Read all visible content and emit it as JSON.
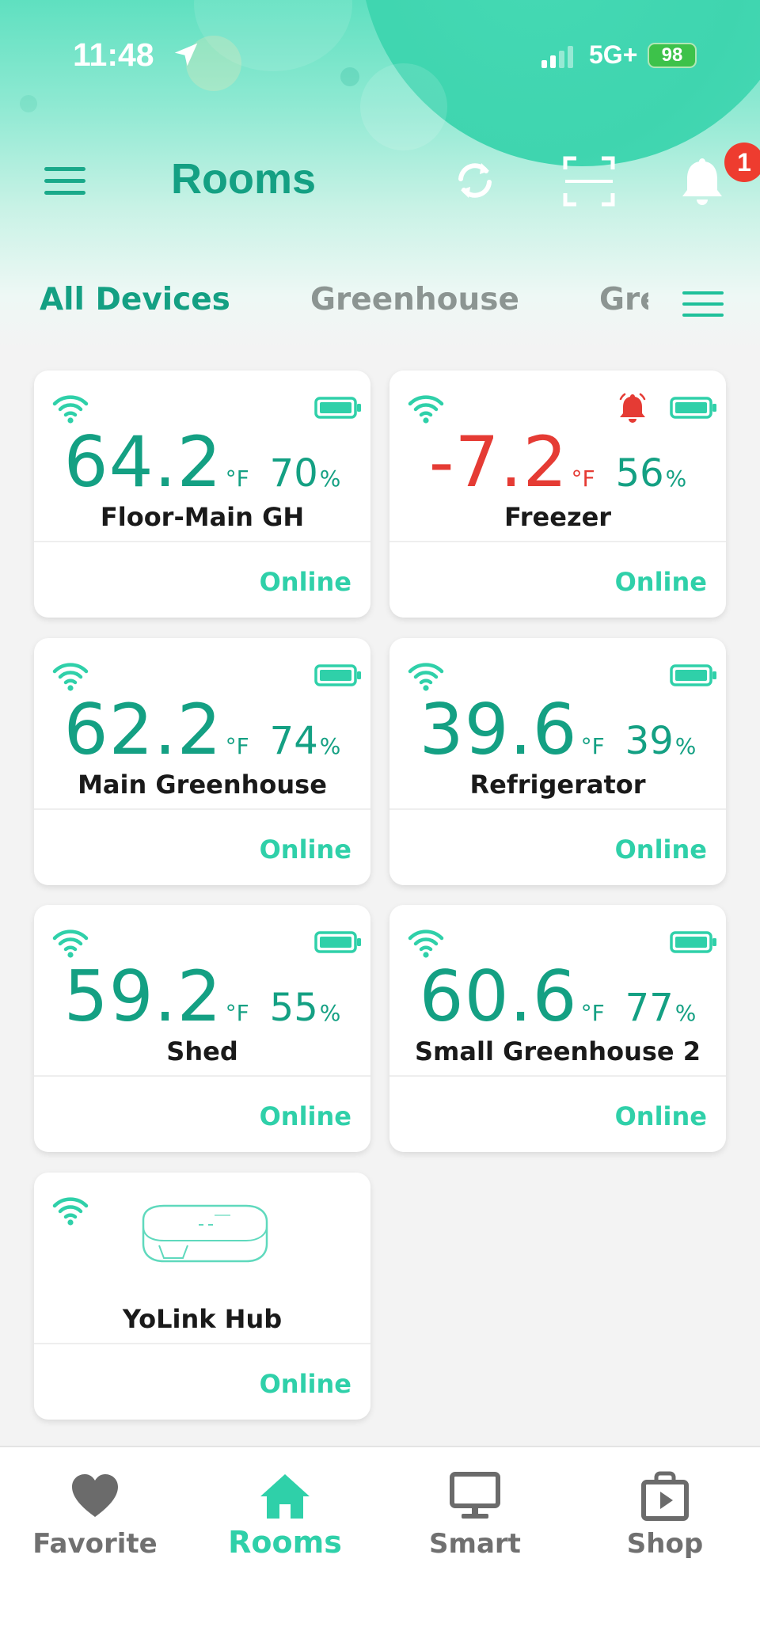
{
  "status_bar": {
    "time": "11:48",
    "network": "5G+",
    "battery": "98"
  },
  "header": {
    "title": "Rooms",
    "notification_count": "1"
  },
  "tabs": [
    {
      "label": "All Devices",
      "active": true
    },
    {
      "label": "Greenhouse",
      "active": false
    },
    {
      "label": "Greenhouse",
      "active": false
    }
  ],
  "devices": [
    {
      "name": "Floor-Main GH",
      "temp": "64.2",
      "temp_unit": "°F",
      "humidity": "70",
      "humidity_unit": "%",
      "status": "Online",
      "alarm": false
    },
    {
      "name": "Freezer",
      "temp": "-7.2",
      "temp_unit": "°F",
      "humidity": "56",
      "humidity_unit": "%",
      "status": "Online",
      "alarm": true
    },
    {
      "name": "Main Greenhouse",
      "temp": "62.2",
      "temp_unit": "°F",
      "humidity": "74",
      "humidity_unit": "%",
      "status": "Online",
      "alarm": false
    },
    {
      "name": "Refrigerator",
      "temp": "39.6",
      "temp_unit": "°F",
      "humidity": "39",
      "humidity_unit": "%",
      "status": "Online",
      "alarm": false
    },
    {
      "name": "Shed",
      "temp": "59.2",
      "temp_unit": "°F",
      "humidity": "55",
      "humidity_unit": "%",
      "status": "Online",
      "alarm": false
    },
    {
      "name": "Small Greenhouse 2",
      "temp": "60.6",
      "temp_unit": "°F",
      "humidity": "77",
      "humidity_unit": "%",
      "status": "Online",
      "alarm": false
    },
    {
      "name": "YoLink Hub",
      "status": "Online",
      "type": "hub"
    }
  ],
  "bottom_nav": [
    {
      "label": "Favorite",
      "icon": "heart-icon",
      "active": false
    },
    {
      "label": "Rooms",
      "icon": "home-icon",
      "active": true
    },
    {
      "label": "Smart",
      "icon": "monitor-icon",
      "active": false
    },
    {
      "label": "Shop",
      "icon": "shopping-bag-icon",
      "active": false
    }
  ],
  "colors": {
    "accent": "#14a083",
    "online": "#2fd0a9",
    "alert": "#e53b34",
    "inactive": "#8c9592"
  }
}
